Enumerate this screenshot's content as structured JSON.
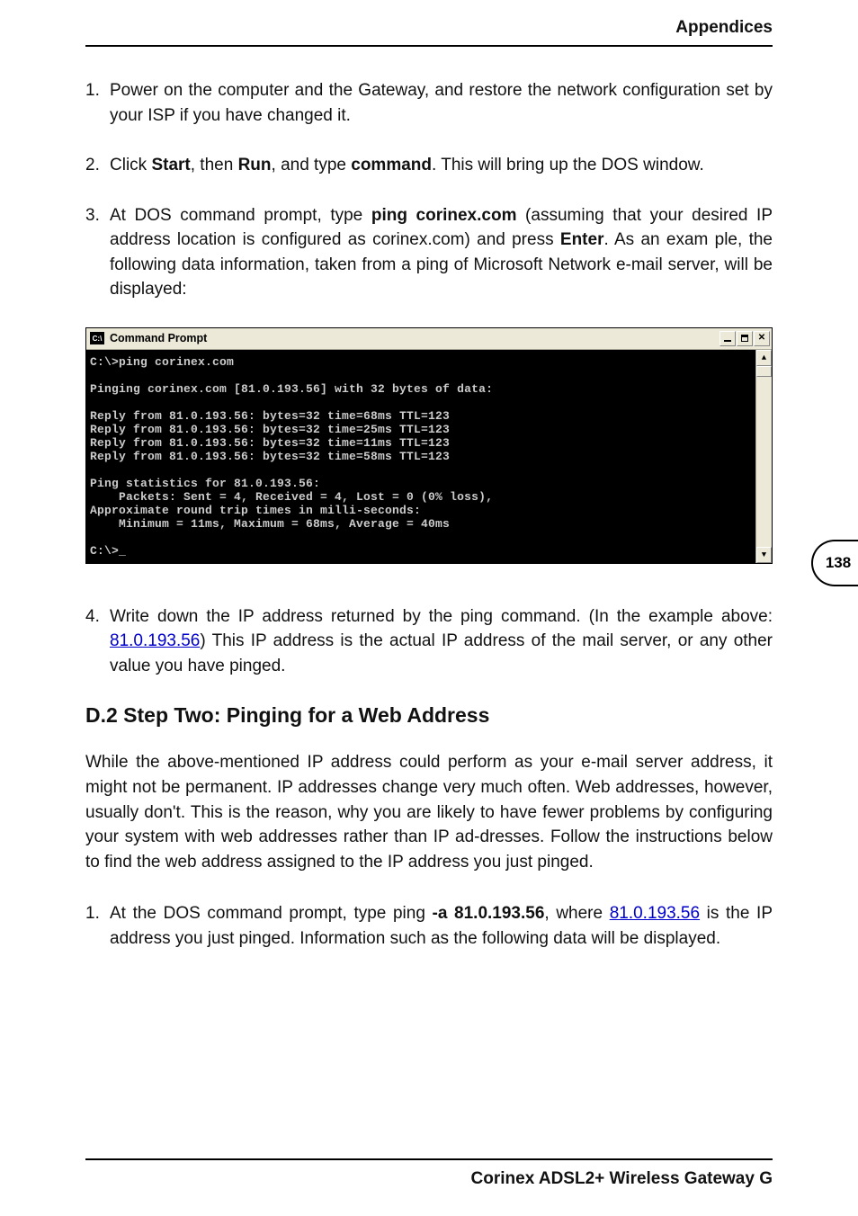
{
  "header": {
    "title": "Appendices"
  },
  "page_number": "138",
  "footer": {
    "text": "Corinex ADSL2+ Wireless Gateway G"
  },
  "steps_a": [
    {
      "num": "1.",
      "parts": [
        {
          "t": "Power on the computer and the Gateway, and restore the network configuration set by your ISP if you have changed it."
        }
      ]
    },
    {
      "num": "2.",
      "parts": [
        {
          "t": "Click "
        },
        {
          "t": "Start",
          "b": true
        },
        {
          "t": ", then "
        },
        {
          "t": "Run",
          "b": true
        },
        {
          "t": ", and type "
        },
        {
          "t": "command",
          "b": true
        },
        {
          "t": ". This will bring up the DOS window."
        }
      ]
    },
    {
      "num": "3.",
      "parts": [
        {
          "t": "At DOS command prompt, type "
        },
        {
          "t": "ping corinex.com",
          "b": true
        },
        {
          "t": " (assuming that your desired IP address location is configured as corinex.com) and press "
        },
        {
          "t": "Enter",
          "b": true
        },
        {
          "t": ". As an exam ple, the following data information, taken from a ping of Microsoft Network e-mail server, will be displayed:"
        }
      ]
    }
  ],
  "cmd": {
    "title": "Command Prompt",
    "icon_text": "C:\\",
    "lines": "C:\\>ping corinex.com\n\nPinging corinex.com [81.0.193.56] with 32 bytes of data:\n\nReply from 81.0.193.56: bytes=32 time=68ms TTL=123\nReply from 81.0.193.56: bytes=32 time=25ms TTL=123\nReply from 81.0.193.56: bytes=32 time=11ms TTL=123\nReply from 81.0.193.56: bytes=32 time=58ms TTL=123\n\nPing statistics for 81.0.193.56:\n    Packets: Sent = 4, Received = 4, Lost = 0 (0% loss),\nApproximate round trip times in milli-seconds:\n    Minimum = 11ms, Maximum = 68ms, Average = 40ms\n\nC:\\>_"
  },
  "steps_b": [
    {
      "num": "4.",
      "parts": [
        {
          "t": "Write down the IP address returned by the ping command. (In the example above: "
        },
        {
          "t": "81.0.193.56",
          "link": true
        },
        {
          "t": ") This IP address is the actual IP address of the mail server, or any other value you have pinged."
        }
      ]
    }
  ],
  "section": {
    "heading": "D.2 Step Two: Pinging for a Web Address"
  },
  "para": "While the above-mentioned IP address could perform as your e-mail server address, it might not be permanent. IP addresses change very much often. Web addresses, however, usually don't. This is the reason, why you are likely to have fewer problems by configuring your system with web addresses rather than IP ad-dresses. Follow the instructions below to find the web address assigned to the IP address you just pinged.",
  "steps_c": [
    {
      "num": "1.",
      "parts": [
        {
          "t": "At the DOS command prompt, type ping "
        },
        {
          "t": "-a 81.0.193.56",
          "b": true
        },
        {
          "t": ", where "
        },
        {
          "t": "81.0.193.56",
          "link": true
        },
        {
          "t": " is the IP address you just pinged. Information such as the following data will be displayed."
        }
      ]
    }
  ]
}
